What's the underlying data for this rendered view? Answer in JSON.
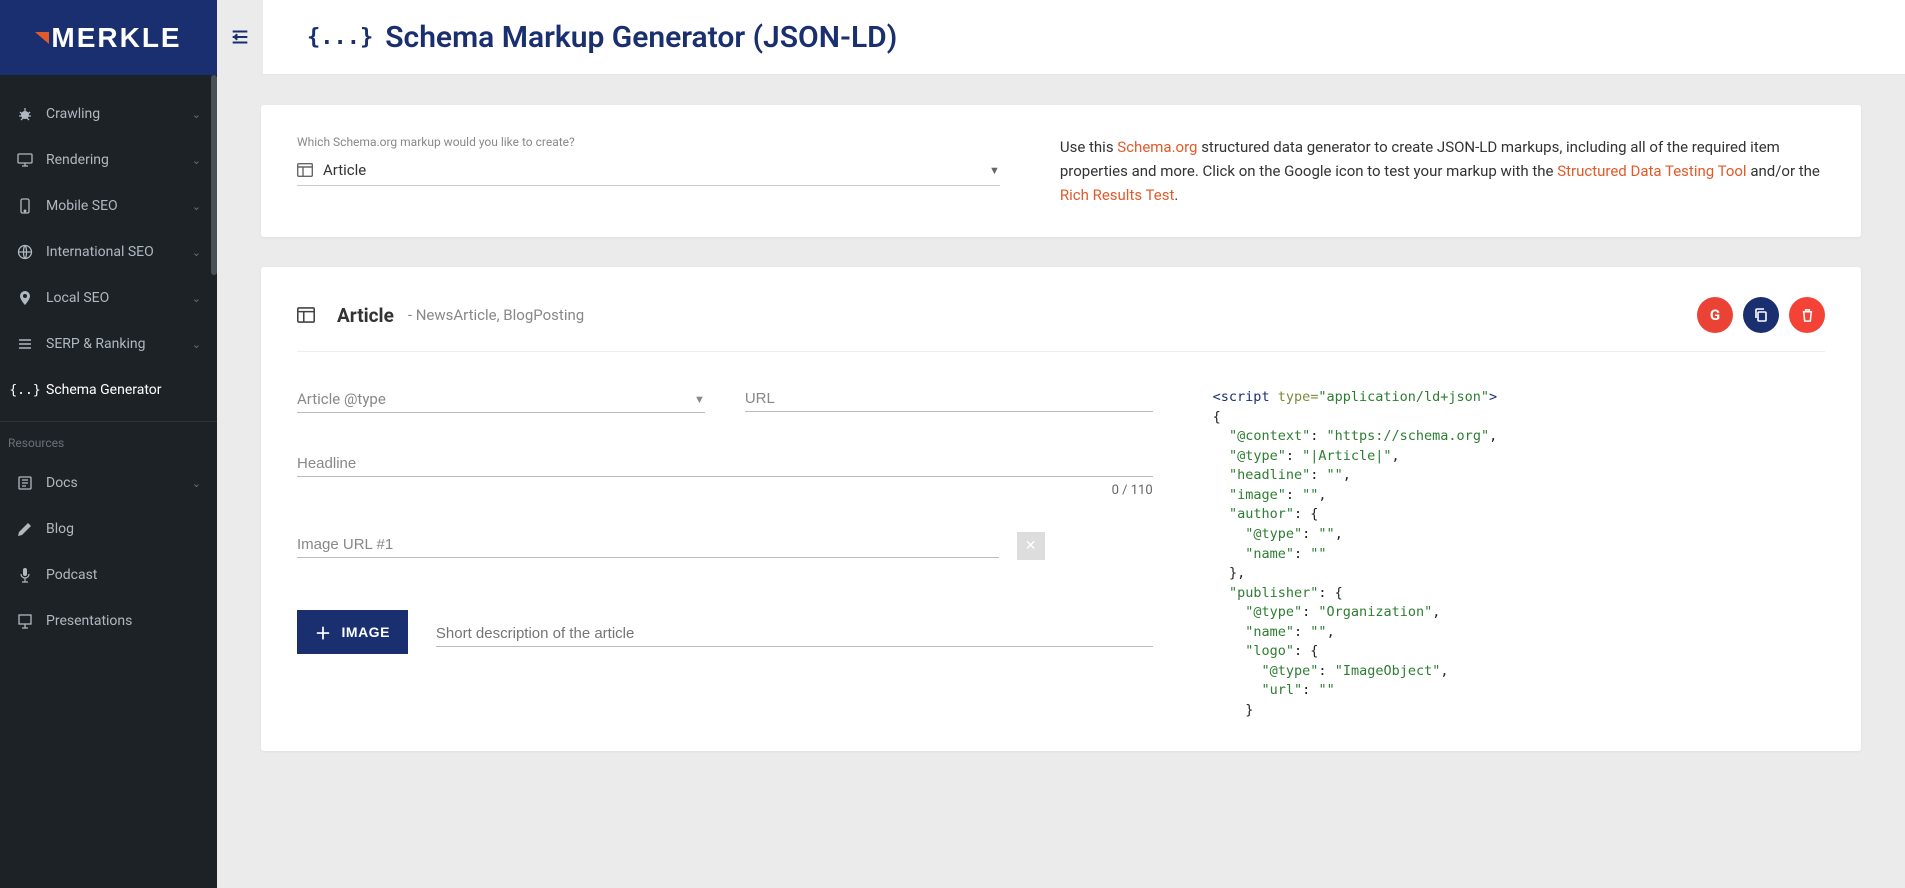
{
  "brand": "MERKLE",
  "header": {
    "icon_text": "{...}",
    "title": "Schema Markup Generator (JSON-LD)"
  },
  "sidebar": {
    "section_label": "Resources",
    "items": [
      {
        "label": "Crawling",
        "expandable": true
      },
      {
        "label": "Rendering",
        "expandable": true
      },
      {
        "label": "Mobile SEO",
        "expandable": true
      },
      {
        "label": "International SEO",
        "expandable": true
      },
      {
        "label": "Local SEO",
        "expandable": true
      },
      {
        "label": "SERP & Ranking",
        "expandable": true
      },
      {
        "label": "Schema Generator",
        "expandable": false,
        "active": true
      }
    ],
    "resources": [
      {
        "label": "Docs",
        "expandable": true
      },
      {
        "label": "Blog",
        "expandable": false
      },
      {
        "label": "Podcast",
        "expandable": false
      },
      {
        "label": "Presentations",
        "expandable": false
      }
    ]
  },
  "intro": {
    "select_label": "Which Schema.org markup would you like to create?",
    "select_value": "Article",
    "text_before_schema": "Use this ",
    "schema_link": "Schema.org",
    "text_mid1": " structured data generator to create JSON-LD markups, including all of the required item properties and more. Click on the Google icon to test your markup with the ",
    "sdtt_link": "Structured Data Testing Tool",
    "text_mid2": " and/or the ",
    "rrt_link": "Rich Results Test",
    "text_end": "."
  },
  "builder": {
    "title": "Article",
    "subtitle": "- NewsArticle, BlogPosting",
    "google_btn_glyph": "G",
    "form": {
      "article_type_label": "Article @type",
      "url_label": "URL",
      "headline_label": "Headline",
      "headline_count": "0 / 110",
      "image_url_label": "Image URL #1",
      "add_image_label": "IMAGE",
      "description_placeholder": "Short description of the article"
    },
    "code": {
      "lines": [
        {
          "t": "tag",
          "text": "<script "
        },
        {
          "t": "attr",
          "text": "type="
        },
        {
          "t": "str",
          "text": "\"application/ld+json\""
        },
        {
          "t": "tag",
          "text": ">"
        }
      ],
      "json_lines": [
        "{",
        "  \"@context\": \"https://schema.org\", ",
        "  \"@type\": \"|Article|\",",
        "  \"headline\": \"\",",
        "  \"image\": \"\",",
        "  \"author\": {",
        "    \"@type\": \"\",",
        "    \"name\": \"\"",
        "  },  ",
        "  \"publisher\": {",
        "    \"@type\": \"Organization\",",
        "    \"name\": \"\",",
        "    \"logo\": {",
        "      \"@type\": \"ImageObject\",",
        "      \"url\": \"\"",
        "    }"
      ]
    }
  }
}
